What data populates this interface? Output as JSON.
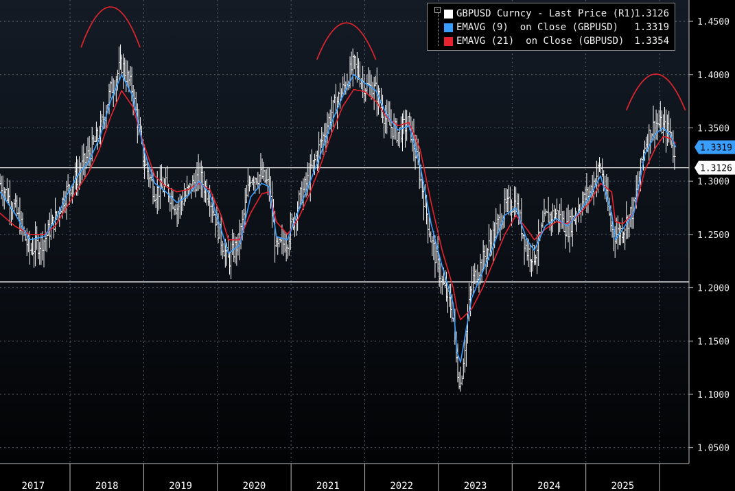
{
  "chart_data": {
    "type": "line",
    "title": "",
    "xlabel": "",
    "ylabel": "",
    "ylim": [
      1.035,
      1.47
    ],
    "x_range": [
      2016.55,
      2025.9
    ],
    "y_ticks": [
      "1.0500",
      "1.1000",
      "1.1500",
      "1.2000",
      "1.2500",
      "1.3000",
      "1.3500",
      "1.4000",
      "1.4500"
    ],
    "x_ticks": [
      "2017",
      "2018",
      "2019",
      "2020",
      "2021",
      "2022",
      "2023",
      "2024",
      "2025"
    ],
    "x_tick_positions": [
      2017,
      2018,
      2019,
      2020,
      2021,
      2022,
      2023,
      2024,
      2025
    ],
    "grid": true,
    "legend_position": "top-right",
    "horizontal_lines": [
      1.3126,
      1.2055
    ],
    "series": [
      {
        "name": "GBPUSD Curncy - Last Price (R1)",
        "last": "1.3126",
        "color": "#ffffff",
        "style": "ohlc-bars",
        "x": [
          2016.55,
          2016.75,
          2016.95,
          2017.15,
          2017.3,
          2017.45,
          2017.6,
          2017.75,
          2017.9,
          2018.05,
          2018.2,
          2018.35,
          2018.5,
          2018.65,
          2018.8,
          2018.95,
          2019.1,
          2019.25,
          2019.4,
          2019.55,
          2019.65,
          2019.8,
          2019.95,
          2020.1,
          2020.2,
          2020.3,
          2020.45,
          2020.6,
          2020.75,
          2020.9,
          2021.05,
          2021.2,
          2021.35,
          2021.5,
          2021.65,
          2021.8,
          2021.95,
          2022.1,
          2022.25,
          2022.4,
          2022.55,
          2022.7,
          2022.75,
          2022.8,
          2022.95,
          2023.1,
          2023.25,
          2023.4,
          2023.55,
          2023.7,
          2023.8,
          2023.95,
          2024.1,
          2024.25,
          2024.4,
          2024.55,
          2024.7,
          2024.85,
          2024.9,
          2025.0,
          2025.15,
          2025.3,
          2025.45,
          2025.55,
          2025.65,
          2025.72
        ],
        "y": [
          1.298,
          1.275,
          1.235,
          1.245,
          1.265,
          1.29,
          1.305,
          1.325,
          1.345,
          1.385,
          1.41,
          1.385,
          1.32,
          1.29,
          1.295,
          1.275,
          1.29,
          1.305,
          1.285,
          1.245,
          1.225,
          1.245,
          1.305,
          1.305,
          1.295,
          1.235,
          1.245,
          1.28,
          1.305,
          1.335,
          1.365,
          1.385,
          1.41,
          1.39,
          1.385,
          1.355,
          1.345,
          1.355,
          1.305,
          1.245,
          1.205,
          1.175,
          1.125,
          1.11,
          1.205,
          1.225,
          1.25,
          1.275,
          1.28,
          1.235,
          1.23,
          1.265,
          1.27,
          1.255,
          1.275,
          1.29,
          1.315,
          1.255,
          1.25,
          1.255,
          1.275,
          1.335,
          1.355,
          1.35,
          1.345,
          1.3126
        ]
      },
      {
        "name": "EMAVG (9)  on Close (GBPUSD)",
        "last": "1.3319",
        "color": "#3a9eff",
        "style": "line",
        "x": [
          2016.55,
          2016.75,
          2016.95,
          2017.15,
          2017.3,
          2017.45,
          2017.6,
          2017.75,
          2017.9,
          2018.05,
          2018.2,
          2018.35,
          2018.5,
          2018.65,
          2018.8,
          2018.95,
          2019.1,
          2019.25,
          2019.4,
          2019.55,
          2019.65,
          2019.8,
          2019.95,
          2020.1,
          2020.2,
          2020.3,
          2020.45,
          2020.6,
          2020.75,
          2020.9,
          2021.05,
          2021.2,
          2021.35,
          2021.5,
          2021.65,
          2021.8,
          2021.95,
          2022.1,
          2022.25,
          2022.4,
          2022.55,
          2022.7,
          2022.75,
          2022.8,
          2022.95,
          2023.1,
          2023.25,
          2023.4,
          2023.55,
          2023.7,
          2023.8,
          2023.95,
          2024.1,
          2024.25,
          2024.4,
          2024.55,
          2024.7,
          2024.85,
          2024.9,
          2025.0,
          2025.15,
          2025.3,
          2025.45,
          2025.55,
          2025.65,
          2025.72
        ],
        "y": [
          1.29,
          1.27,
          1.245,
          1.248,
          1.263,
          1.286,
          1.305,
          1.318,
          1.34,
          1.375,
          1.4,
          1.38,
          1.33,
          1.298,
          1.29,
          1.28,
          1.286,
          1.3,
          1.288,
          1.255,
          1.232,
          1.24,
          1.285,
          1.298,
          1.295,
          1.248,
          1.245,
          1.272,
          1.298,
          1.325,
          1.355,
          1.38,
          1.4,
          1.392,
          1.385,
          1.362,
          1.348,
          1.352,
          1.315,
          1.26,
          1.22,
          1.185,
          1.14,
          1.13,
          1.19,
          1.215,
          1.24,
          1.268,
          1.275,
          1.245,
          1.235,
          1.258,
          1.265,
          1.258,
          1.27,
          1.285,
          1.305,
          1.27,
          1.245,
          1.255,
          1.27,
          1.325,
          1.345,
          1.35,
          1.343,
          1.3319
        ]
      },
      {
        "name": "EMAVG (21)  on Close (GBPUSD)",
        "last": "1.3354",
        "color": "#e8232e",
        "style": "line",
        "x": [
          2016.55,
          2016.75,
          2016.95,
          2017.15,
          2017.3,
          2017.45,
          2017.6,
          2017.75,
          2017.9,
          2018.05,
          2018.2,
          2018.35,
          2018.5,
          2018.65,
          2018.8,
          2018.95,
          2019.1,
          2019.25,
          2019.4,
          2019.55,
          2019.65,
          2019.8,
          2019.95,
          2020.1,
          2020.2,
          2020.3,
          2020.45,
          2020.6,
          2020.75,
          2020.9,
          2021.05,
          2021.2,
          2021.35,
          2021.5,
          2021.65,
          2021.8,
          2021.95,
          2022.1,
          2022.25,
          2022.4,
          2022.55,
          2022.7,
          2022.75,
          2022.8,
          2022.95,
          2023.1,
          2023.25,
          2023.4,
          2023.55,
          2023.7,
          2023.8,
          2023.95,
          2024.1,
          2024.25,
          2024.4,
          2024.55,
          2024.7,
          2024.85,
          2024.9,
          2025.0,
          2025.15,
          2025.3,
          2025.45,
          2025.55,
          2025.65,
          2025.72
        ],
        "y": [
          1.27,
          1.258,
          1.25,
          1.25,
          1.258,
          1.275,
          1.292,
          1.308,
          1.33,
          1.36,
          1.385,
          1.37,
          1.335,
          1.305,
          1.295,
          1.29,
          1.292,
          1.298,
          1.292,
          1.268,
          1.245,
          1.245,
          1.27,
          1.288,
          1.29,
          1.262,
          1.25,
          1.265,
          1.288,
          1.315,
          1.345,
          1.37,
          1.386,
          1.384,
          1.375,
          1.36,
          1.352,
          1.355,
          1.33,
          1.28,
          1.235,
          1.2,
          1.18,
          1.17,
          1.18,
          1.2,
          1.225,
          1.25,
          1.268,
          1.255,
          1.245,
          1.255,
          1.262,
          1.26,
          1.268,
          1.28,
          1.298,
          1.29,
          1.262,
          1.26,
          1.27,
          1.31,
          1.332,
          1.342,
          1.34,
          1.3354
        ]
      }
    ],
    "annotations": {
      "arcs": [
        {
          "x": [
            2017.65,
            2018.45
          ],
          "y_base": 1.4255,
          "y_peak": 1.4635
        },
        {
          "x": [
            2020.85,
            2021.65
          ],
          "y_base": 1.414,
          "y_peak": 1.4485
        },
        {
          "x": [
            2025.05,
            2025.85
          ],
          "y_base": 1.3665,
          "y_peak": 1.4005
        }
      ]
    }
  },
  "legend": {
    "items": [
      {
        "label": "GBPUSD Curncy - Last Price (R1)",
        "value": "1.3126",
        "color": "#ffffff"
      },
      {
        "label": "EMAVG (9)  on Close (GBPUSD)",
        "value": "1.3319",
        "color": "#3a9eff"
      },
      {
        "label": "EMAVG (21)  on Close (GBPUSD)",
        "value": "1.3354",
        "color": "#e8232e"
      }
    ]
  },
  "badges": {
    "ema21": {
      "value": "1.3354",
      "color": "#e8232e"
    },
    "ema9": {
      "value": "1.3319",
      "color": "#3a9eff"
    },
    "last": {
      "value": "1.3126",
      "color": "#ffffff"
    }
  }
}
